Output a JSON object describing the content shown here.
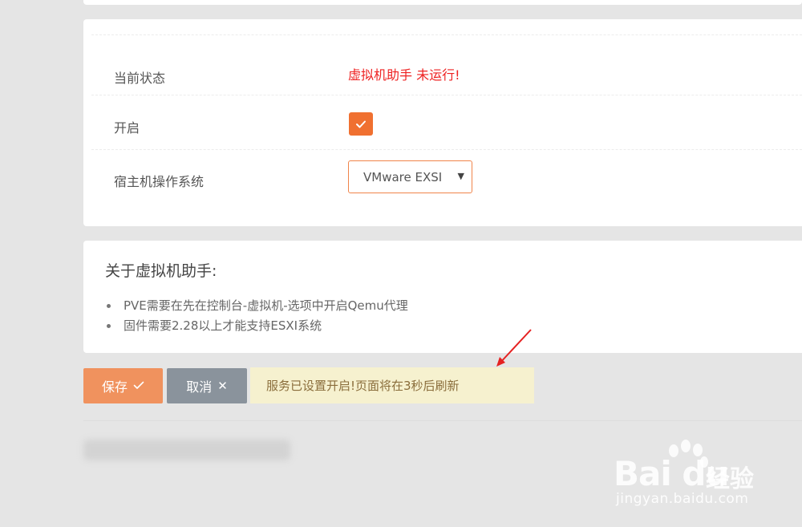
{
  "settings": {
    "status_label": "当前状态",
    "status_value": "虚拟机助手 未运行!",
    "enable_label": "开启",
    "enable_checked": true,
    "host_os_label": "宿主机操作系统",
    "host_os_selected": "VMware EXSI"
  },
  "about": {
    "title": "关于虚拟机助手:",
    "items": [
      "PVE需要在先在控制台-虚拟机-选项中开启Qemu代理",
      "固件需要2.28以上才能支持ESXI系统"
    ]
  },
  "actions": {
    "save_label": "保存",
    "cancel_label": "取消"
  },
  "notice": {
    "text": "服务已设置开启!页面将在3秒后刷新"
  },
  "watermark": {
    "brand": "Bai du",
    "cn": "经验",
    "url": "jingyan.baidu.com"
  },
  "colors": {
    "accent": "#f07030",
    "save_button": "#f0925e",
    "cancel_button": "#8a939c",
    "status_error": "#ee2222",
    "notice_bg": "#f6f1cf",
    "notice_text": "#8a6d3b"
  },
  "icons": {
    "checkbox": "checkmark-icon",
    "select": "caret-down-icon",
    "save": "checkmark-icon",
    "cancel": "close-icon"
  }
}
